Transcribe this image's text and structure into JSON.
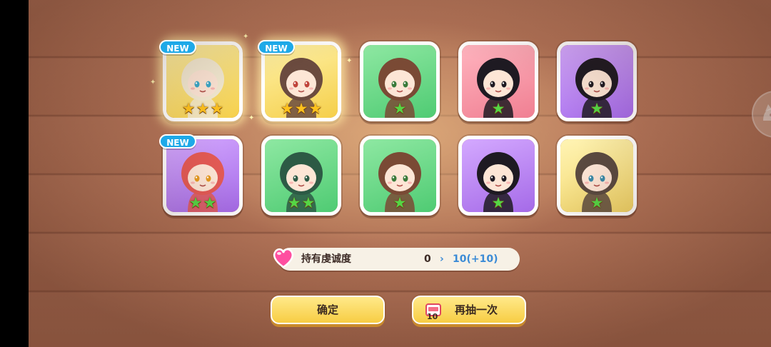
{
  "cards": [
    {
      "rarity": "gold",
      "stars": 3,
      "star_color": "gold",
      "new": true,
      "hair": "#f3ead2",
      "skin": "#fde6d6",
      "eyes": "#3aa8c8",
      "glow": true
    },
    {
      "rarity": "gold",
      "stars": 3,
      "star_color": "gold",
      "new": true,
      "hair": "#6b4b3f",
      "skin": "#fde6d6",
      "eyes": "#c0433a",
      "glow": true
    },
    {
      "rarity": "green",
      "stars": 1,
      "star_color": "green",
      "new": false,
      "hair": "#7a4a35",
      "skin": "#fde6d6",
      "eyes": "#3a7a3a",
      "glow": false
    },
    {
      "rarity": "pink",
      "stars": 1,
      "star_color": "green",
      "new": false,
      "hair": "#1e1a22",
      "skin": "#fde6d6",
      "eyes": "#1e1a22",
      "glow": false
    },
    {
      "rarity": "purple",
      "stars": 1,
      "star_color": "green",
      "new": false,
      "hair": "#1e1a22",
      "skin": "#fde6d6",
      "eyes": "#1e1a22",
      "glow": false
    },
    {
      "rarity": "purple",
      "stars": 2,
      "star_color": "green",
      "new": true,
      "hair": "#e35a55",
      "skin": "#fde6d6",
      "eyes": "#e59a20",
      "glow": false
    },
    {
      "rarity": "green",
      "stars": 2,
      "star_color": "green",
      "new": false,
      "hair": "#2d5a45",
      "skin": "#fde6d6",
      "eyes": "#2d5a45",
      "glow": false
    },
    {
      "rarity": "green",
      "stars": 1,
      "star_color": "green",
      "new": false,
      "hair": "#7a4a35",
      "skin": "#fde6d6",
      "eyes": "#3a7a3a",
      "glow": false
    },
    {
      "rarity": "purple",
      "stars": 1,
      "star_color": "green",
      "new": false,
      "hair": "#1e1a22",
      "skin": "#fde6d6",
      "eyes": "#1e1a22",
      "glow": false
    },
    {
      "rarity": "yellow",
      "stars": 1,
      "star_color": "green",
      "new": false,
      "hair": "#5a4a40",
      "skin": "#fde6d6",
      "eyes": "#3a8aa8",
      "glow": false
    }
  ],
  "new_badge_label": "NEW",
  "devotion": {
    "label": "持有虔诚度",
    "current": "0",
    "arrow": "›",
    "next": "10(+10)",
    "heart_color": "#ff4fa0"
  },
  "buttons": {
    "confirm_label": "确定",
    "redraw_label": "再抽一次",
    "ticket_count": "10"
  },
  "colors": {
    "accent_yellow": "#f7cd43",
    "badge_blue": "#1ea9e8"
  }
}
